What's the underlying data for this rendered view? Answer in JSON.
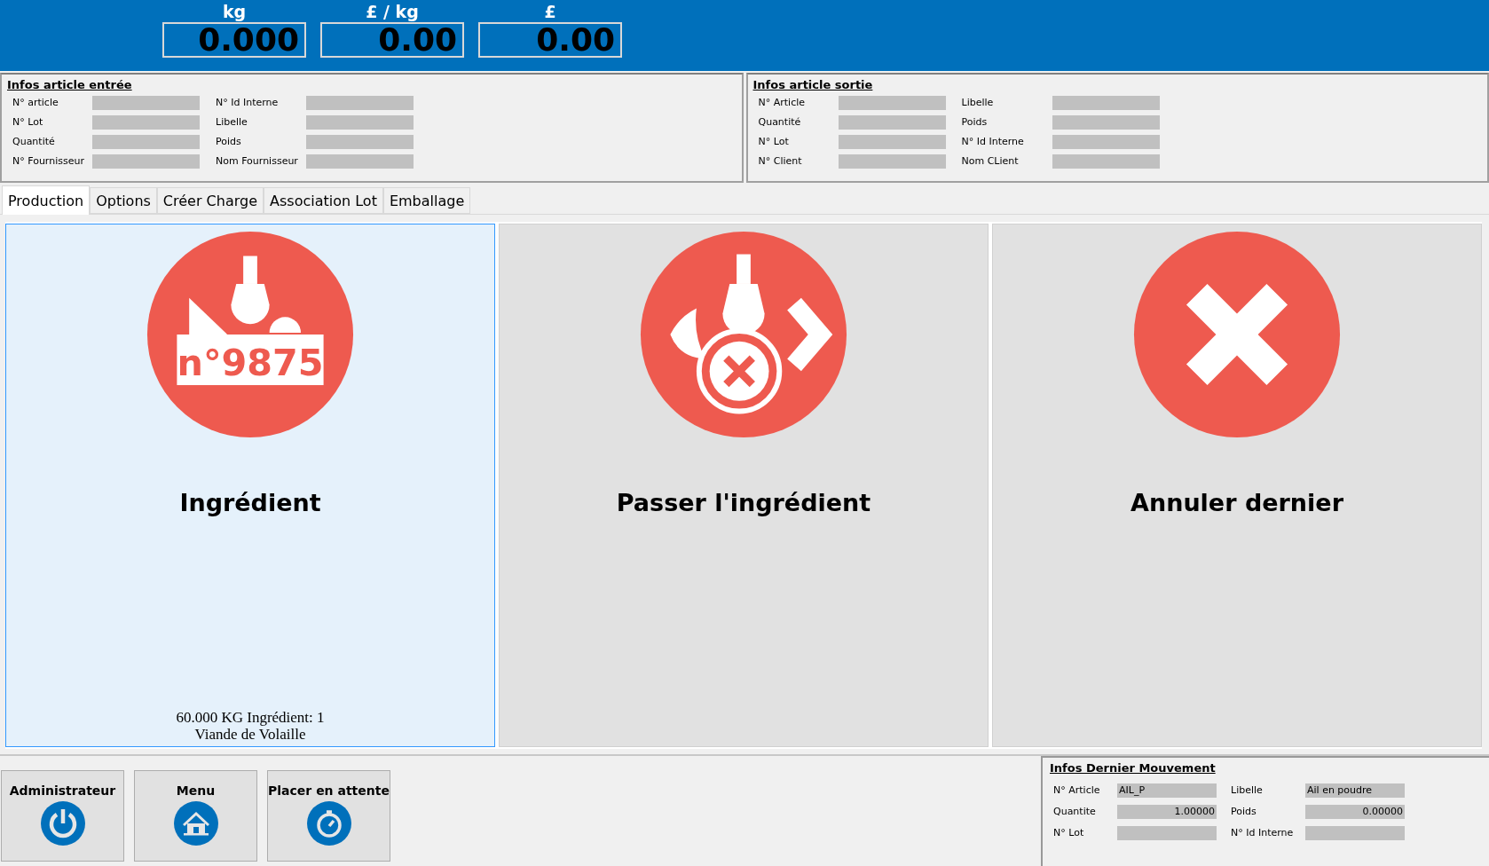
{
  "displays": [
    {
      "unit": "kg",
      "value": "0.000"
    },
    {
      "unit": "£ / kg",
      "value": "0.00"
    },
    {
      "unit": "£",
      "value": "0.00"
    }
  ],
  "info_panels": [
    {
      "title": "Infos article entrée",
      "fields": [
        {
          "label": "N° article"
        },
        {
          "label": "N° Id Interne"
        },
        {
          "label": "N° Lot"
        },
        {
          "label": "Libelle"
        },
        {
          "label": "Quantité"
        },
        {
          "label": "Poids"
        },
        {
          "label": "N° Fournisseur"
        },
        {
          "label": "Nom Fournisseur"
        }
      ]
    },
    {
      "title": "Infos article sortie",
      "fields": [
        {
          "label": "N° Article"
        },
        {
          "label": "Libelle"
        },
        {
          "label": "Quantité"
        },
        {
          "label": "Poids"
        },
        {
          "label": "N° Lot"
        },
        {
          "label": "N° Id Interne"
        },
        {
          "label": "N° Client"
        },
        {
          "label": "Nom CLient"
        }
      ]
    }
  ],
  "tabs": [
    {
      "label": "Production",
      "selected": true
    },
    {
      "label": "Options",
      "selected": false
    },
    {
      "label": "Créer Charge",
      "selected": false
    },
    {
      "label": "Association Lot",
      "selected": false
    },
    {
      "label": "Emballage",
      "selected": false
    }
  ],
  "tiles": [
    {
      "kind": "ingredient",
      "title": "Ingrédient",
      "icon_text": "n°9875",
      "selected": true,
      "footer": [
        "60.000 KG Ingrédient: 1",
        "Viande de Volaille"
      ]
    },
    {
      "kind": "skip",
      "title": "Passer l'ingrédient",
      "selected": false
    },
    {
      "kind": "cancel",
      "title": "Annuler dernier",
      "selected": false
    }
  ],
  "bottom_buttons": [
    {
      "kind": "power",
      "label": "Administrateur"
    },
    {
      "kind": "home",
      "label": "Menu"
    },
    {
      "kind": "timer",
      "label": "Placer en attente"
    }
  ],
  "last_movement": {
    "title": "Infos Dernier Mouvement",
    "fields": [
      {
        "label": "N° Article",
        "value": "AIL_P",
        "kind": "text"
      },
      {
        "label": "Libelle",
        "value": "Ail en poudre",
        "kind": "text"
      },
      {
        "label": "Quantite",
        "value": "1.00000",
        "kind": "number"
      },
      {
        "label": "Poids",
        "value": "0.00000",
        "kind": "number"
      },
      {
        "label": "N° Lot",
        "kind": "text"
      },
      {
        "label": "N° Id Interne",
        "kind": "text"
      }
    ]
  }
}
